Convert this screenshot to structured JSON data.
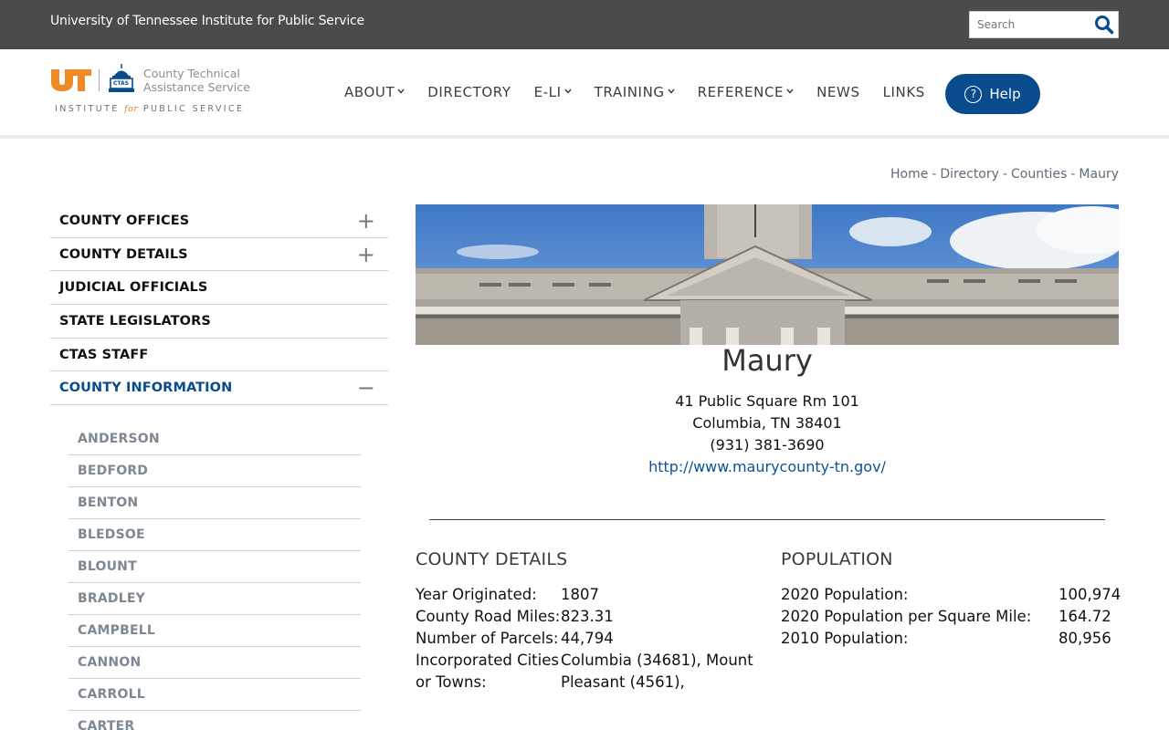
{
  "topbar": {
    "org_name": "University of Tennessee Institute for Public Service",
    "search_placeholder": "Search"
  },
  "logo": {
    "ut_text": "UT",
    "ctas_badge": "CTAS",
    "name_line1": "County Technical",
    "name_line2": "Assistance Service",
    "tagline_pre": "INSTITUTE ",
    "tagline_for": "for",
    "tagline_post": " PUBLIC SERVICE"
  },
  "nav": {
    "items": [
      {
        "label": "ABOUT",
        "dropdown": true
      },
      {
        "label": "DIRECTORY",
        "dropdown": false
      },
      {
        "label": "E-LI",
        "dropdown": true
      },
      {
        "label": "TRAINING",
        "dropdown": true
      },
      {
        "label": "REFERENCE",
        "dropdown": true
      },
      {
        "label": "NEWS",
        "dropdown": false
      },
      {
        "label": "LINKS",
        "dropdown": false
      }
    ],
    "help_label": "Help"
  },
  "breadcrumb": [
    "Home",
    "Directory",
    "Counties",
    "Maury"
  ],
  "sidebar": {
    "items": [
      {
        "label": "COUNTY OFFICES",
        "toggle": "+"
      },
      {
        "label": "COUNTY DETAILS",
        "toggle": "+"
      },
      {
        "label": "JUDICIAL OFFICIALS",
        "toggle": ""
      },
      {
        "label": "STATE LEGISLATORS",
        "toggle": ""
      },
      {
        "label": "CTAS STAFF",
        "toggle": ""
      },
      {
        "label": "COUNTY INFORMATION",
        "toggle": "−"
      }
    ],
    "counties": [
      "ANDERSON",
      "BEDFORD",
      "BENTON",
      "BLEDSOE",
      "BLOUNT",
      "BRADLEY",
      "CAMPBELL",
      "CANNON",
      "CARROLL",
      "CARTER"
    ]
  },
  "county": {
    "name": "Maury",
    "address1": "41 Public Square Rm 101",
    "address2": "Columbia, TN 38401",
    "phone": "(931) 381-3690",
    "website": "http://www.maurycounty-tn.gov/"
  },
  "details": {
    "title": "COUNTY DETAILS",
    "rows": [
      {
        "label": "Year Originated:",
        "value": "1807"
      },
      {
        "label": "County Road Miles:",
        "value": "823.31"
      },
      {
        "label": "Number of Parcels:",
        "value": "44,794"
      },
      {
        "label": "Incorporated Cities or Towns:",
        "value": "Columbia (34681), Mount Pleasant (4561),"
      }
    ]
  },
  "population": {
    "title": "POPULATION",
    "rows": [
      {
        "label": "2020 Population:",
        "value": "100,974"
      },
      {
        "label": "2020 Population per Square Mile:",
        "value": "164.72"
      },
      {
        "label": "2010 Population:",
        "value": "80,956"
      }
    ]
  },
  "colors": {
    "topbar": "#4b4b4d",
    "brand_blue": "#084c8d",
    "ut_orange": "#f08a24"
  }
}
